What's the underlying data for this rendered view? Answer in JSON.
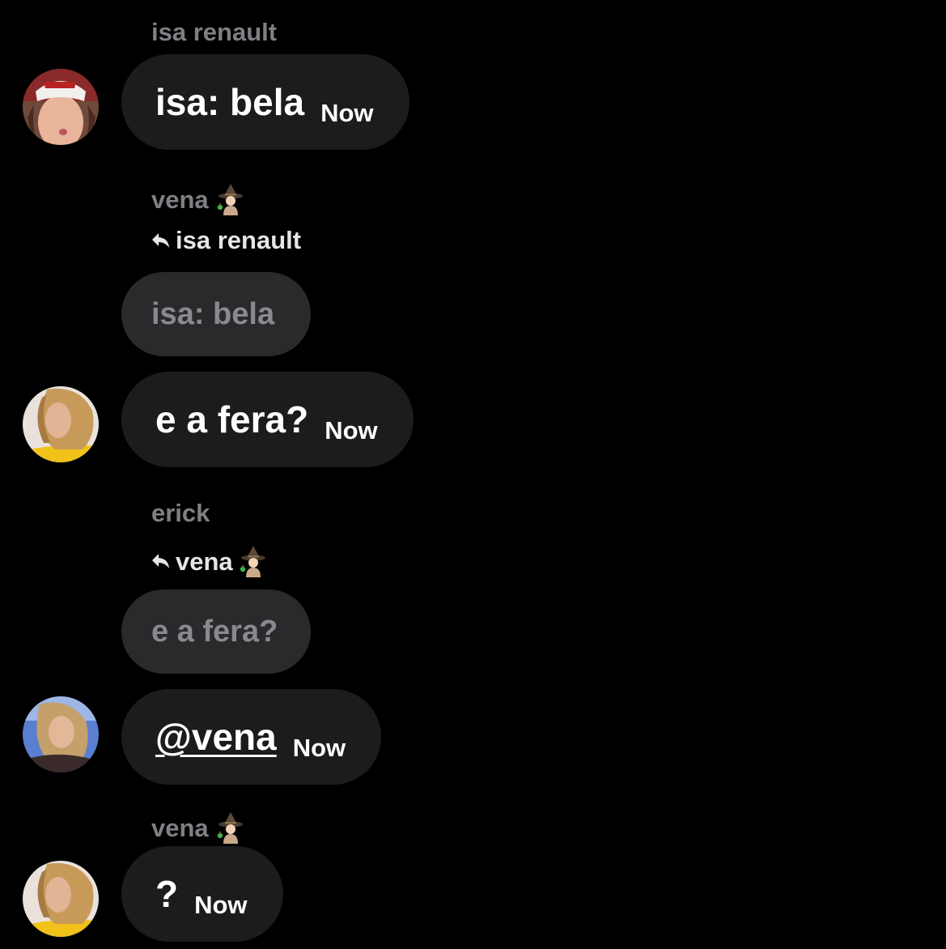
{
  "messages": [
    {
      "sender": "isa renault",
      "text": "isa: bela",
      "time": "Now"
    },
    {
      "sender": "vena",
      "sender_icon": "witch-emoji",
      "reply_to": "isa renault",
      "quoted_text": "isa: bela",
      "text": "e a fera?",
      "time": "Now"
    },
    {
      "sender": "erick",
      "reply_to": "vena",
      "reply_to_icon": "witch-emoji",
      "quoted_text": "e a fera?",
      "text": "@vena",
      "time": "Now"
    },
    {
      "sender": "vena",
      "sender_icon": "witch-emoji",
      "text": "?",
      "time": "Now"
    }
  ],
  "colors": {
    "background": "#000000",
    "bubble": "#1c1c1e",
    "quoted_bubble": "#2a2a2c",
    "sender_name": "#7f8084",
    "text": "#ffffff"
  }
}
